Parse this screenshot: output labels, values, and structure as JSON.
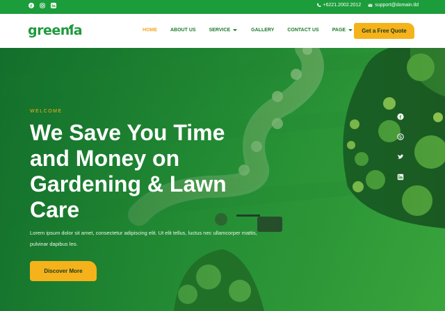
{
  "topbar": {
    "social_icons": [
      "facebook-icon",
      "instagram-icon",
      "linkedin-icon"
    ],
    "phone": "+6221.2002.2012",
    "email": "support@domain.tld"
  },
  "header": {
    "logo_text": "greenia",
    "nav": [
      {
        "label": "HOME",
        "active": true,
        "dropdown": false
      },
      {
        "label": "ABOUT US",
        "active": false,
        "dropdown": false
      },
      {
        "label": "SERVICE",
        "active": false,
        "dropdown": true
      },
      {
        "label": "GALLERY",
        "active": false,
        "dropdown": false
      },
      {
        "label": "CONTACT US",
        "active": false,
        "dropdown": false
      },
      {
        "label": "PAGE",
        "active": false,
        "dropdown": true
      }
    ],
    "cta_label": "Get a Free Quote"
  },
  "hero": {
    "eyebrow": "WELCOME",
    "headline": "We Save You Time and Money on Gardening & Lawn Care",
    "lead": "Lorem ipsum dolor sit amet, consectetur adipiscing elit. Ut elit tellus, luctus nec ullamcorper mattis, pulvinar dapibus leo.",
    "button_label": "Discover More",
    "side_social_icons": [
      "facebook-icon",
      "skype-icon",
      "twitter-icon",
      "linkedin-icon"
    ]
  },
  "colors": {
    "brand_green": "#1f9a3b",
    "accent_yellow": "#f5b21b",
    "topbar_green": "#1c9d3b",
    "nav_text": "#1f7a2e"
  }
}
